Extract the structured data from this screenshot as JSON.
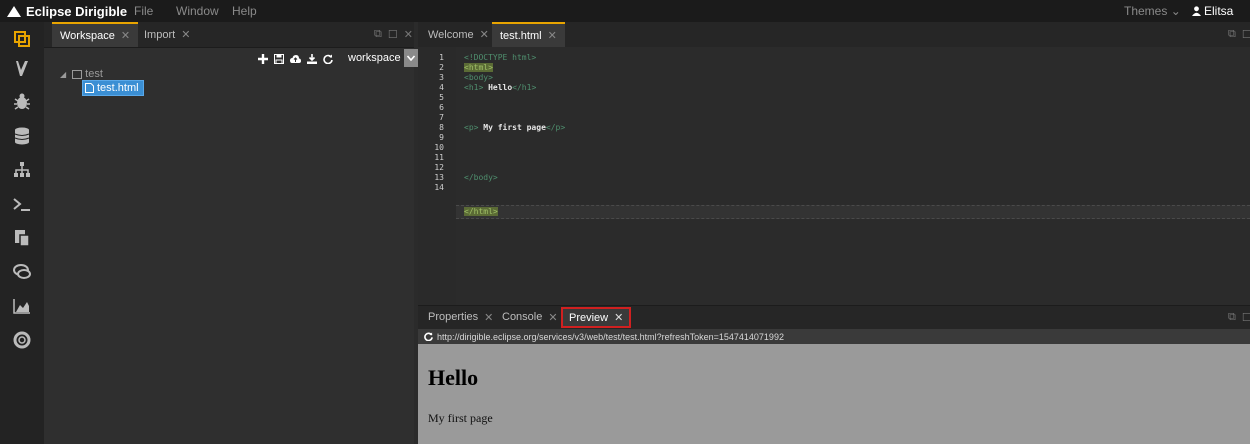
{
  "app": {
    "title": "Eclipse Dirigible"
  },
  "menu": {
    "items": [
      "File",
      "Window",
      "Help"
    ],
    "themes": "Themes",
    "user": "Elitsa"
  },
  "workspace_panel": {
    "tabs": [
      {
        "label": "Workspace"
      },
      {
        "label": "Import"
      }
    ],
    "selected_workspace": "workspace",
    "tree": {
      "project": "test",
      "file": "test.html"
    }
  },
  "editor": {
    "tabs": [
      {
        "label": "Welcome"
      },
      {
        "label": "test.html"
      }
    ],
    "line_numbers": [
      "1",
      "2",
      "3",
      "4",
      "5",
      "6",
      "7",
      "8",
      "9",
      "10",
      "11",
      "12",
      "13",
      "14"
    ],
    "code": {
      "l1": "<!DOCTYPE html>",
      "l2_open": "<html>",
      "l3": "<body>",
      "l4_open": "<h1>",
      "l4_text": " Hello",
      "l4_close": "</h1>",
      "l7_open": "<p>",
      "l7_text": " My first page",
      "l7_close": "</p>",
      "l11": "</body>",
      "l14": "</html>"
    }
  },
  "bottom_panel": {
    "tabs": [
      {
        "label": "Properties"
      },
      {
        "label": "Console"
      },
      {
        "label": "Preview"
      }
    ],
    "url": "http://dirigible.eclipse.org/services/v3/web/test/test.html?refreshToken=1547414071992",
    "preview": {
      "heading": "Hello",
      "paragraph": "My first page"
    }
  },
  "colors": {
    "accent": "#e8a400",
    "selection": "#3b8fd4",
    "preview_highlight": "#d02020"
  }
}
